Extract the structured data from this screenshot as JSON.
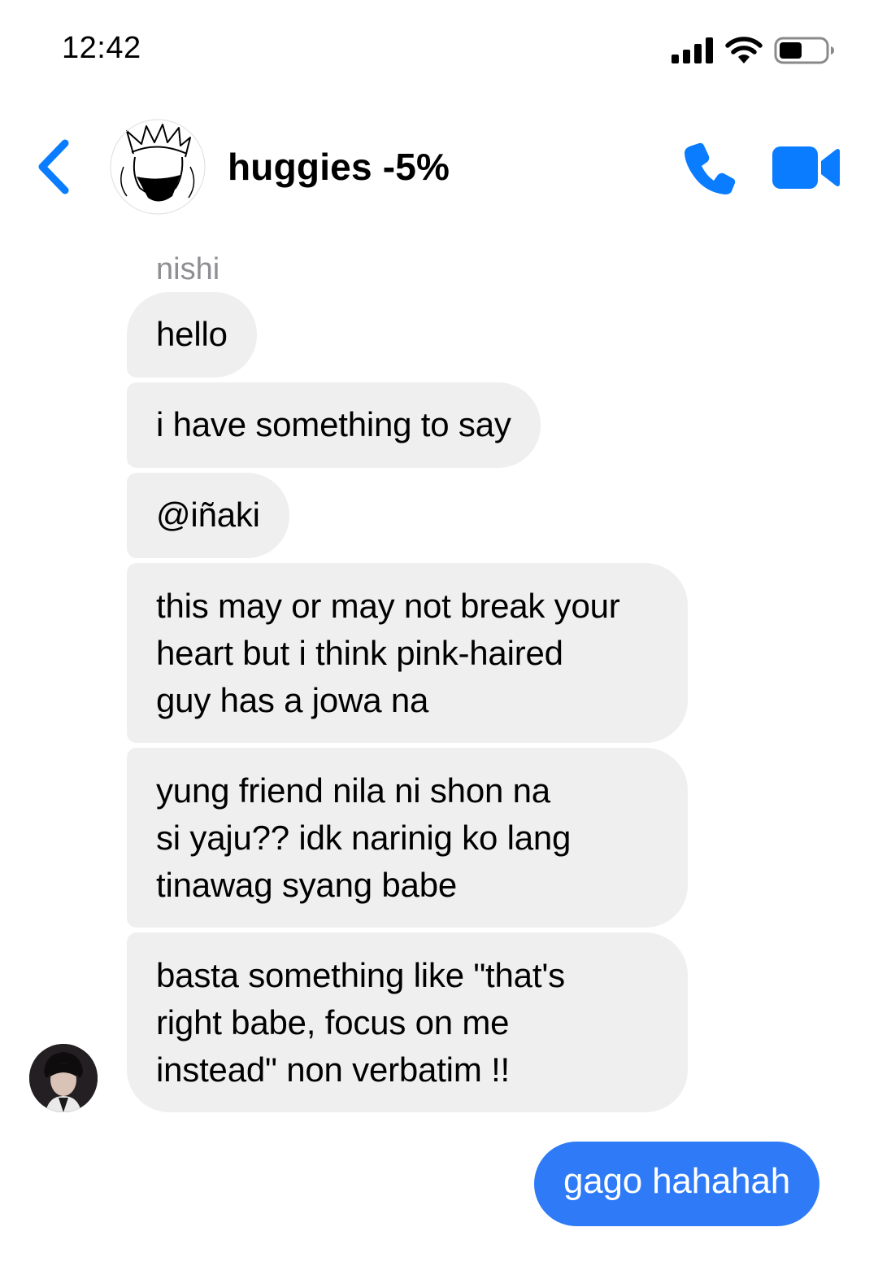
{
  "status_bar": {
    "time": "12:42",
    "icons": [
      "cellular-signal-icon",
      "wifi-icon",
      "battery-icon"
    ],
    "battery_level": 0.5
  },
  "header": {
    "title": "huggies -5%",
    "back_icon": "chevron-left-icon",
    "call_icon": "phone-icon",
    "video_icon": "video-camera-icon",
    "accent_color": "#0a7cff"
  },
  "thread": {
    "sender_name": "nishi",
    "incoming": [
      "hello",
      "i have something to say",
      "@iñaki",
      "this may or may not break your\nheart but i think pink-haired\nguy has a jowa na",
      "yung friend nila ni shon na\nsi yaju?? idk narinig ko lang\ntinawag syang babe",
      "basta something like \"that's\nright babe, focus on me\ninstead\" non verbatim !!"
    ],
    "outgoing": [
      "gago hahahah"
    ],
    "incoming_bubble_color": "#efefef",
    "outgoing_bubble_color": "#2e7af7"
  }
}
